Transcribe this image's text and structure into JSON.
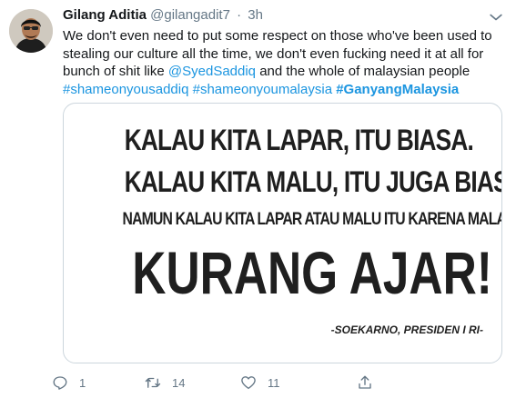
{
  "tweet": {
    "display_name": "Gilang Aditia",
    "handle": "@gilangadit7",
    "separator": "·",
    "time": "3h",
    "text_part1": "We don't even need to put some respect on those who've been used to stealing our culture all the time, we don't even fucking need it at all for bunch of shit like ",
    "mention": "@SyedSaddiq",
    "text_part2": " and the whole of malaysian people ",
    "hashtag1": "#shameonyousaddiq",
    "hashtag2": "#shameonyoumalaysia",
    "hashtag3": "#GanyangMalaysia",
    "space": " "
  },
  "image": {
    "line1": "Kalau kita lapar, itu biasa.",
    "line2": "Kalau kita malu, itu juga biasa.",
    "line3": "Namun kalau kita lapar atau malu itu karena Malaysia,",
    "line4": "Kurang ajar!",
    "attribution": "-SOEKARNO, PRESIDEN I RI-"
  },
  "actions": {
    "reply_count": "1",
    "retweet_count": "14",
    "like_count": "11"
  },
  "icons": {
    "caret": "chevron-down-icon",
    "reply": "reply-icon",
    "retweet": "retweet-icon",
    "like": "heart-icon",
    "share": "share-icon"
  },
  "colors": {
    "link": "#1b95e0",
    "muted": "#657786",
    "text": "#14171a",
    "border": "#ccd6dd"
  }
}
